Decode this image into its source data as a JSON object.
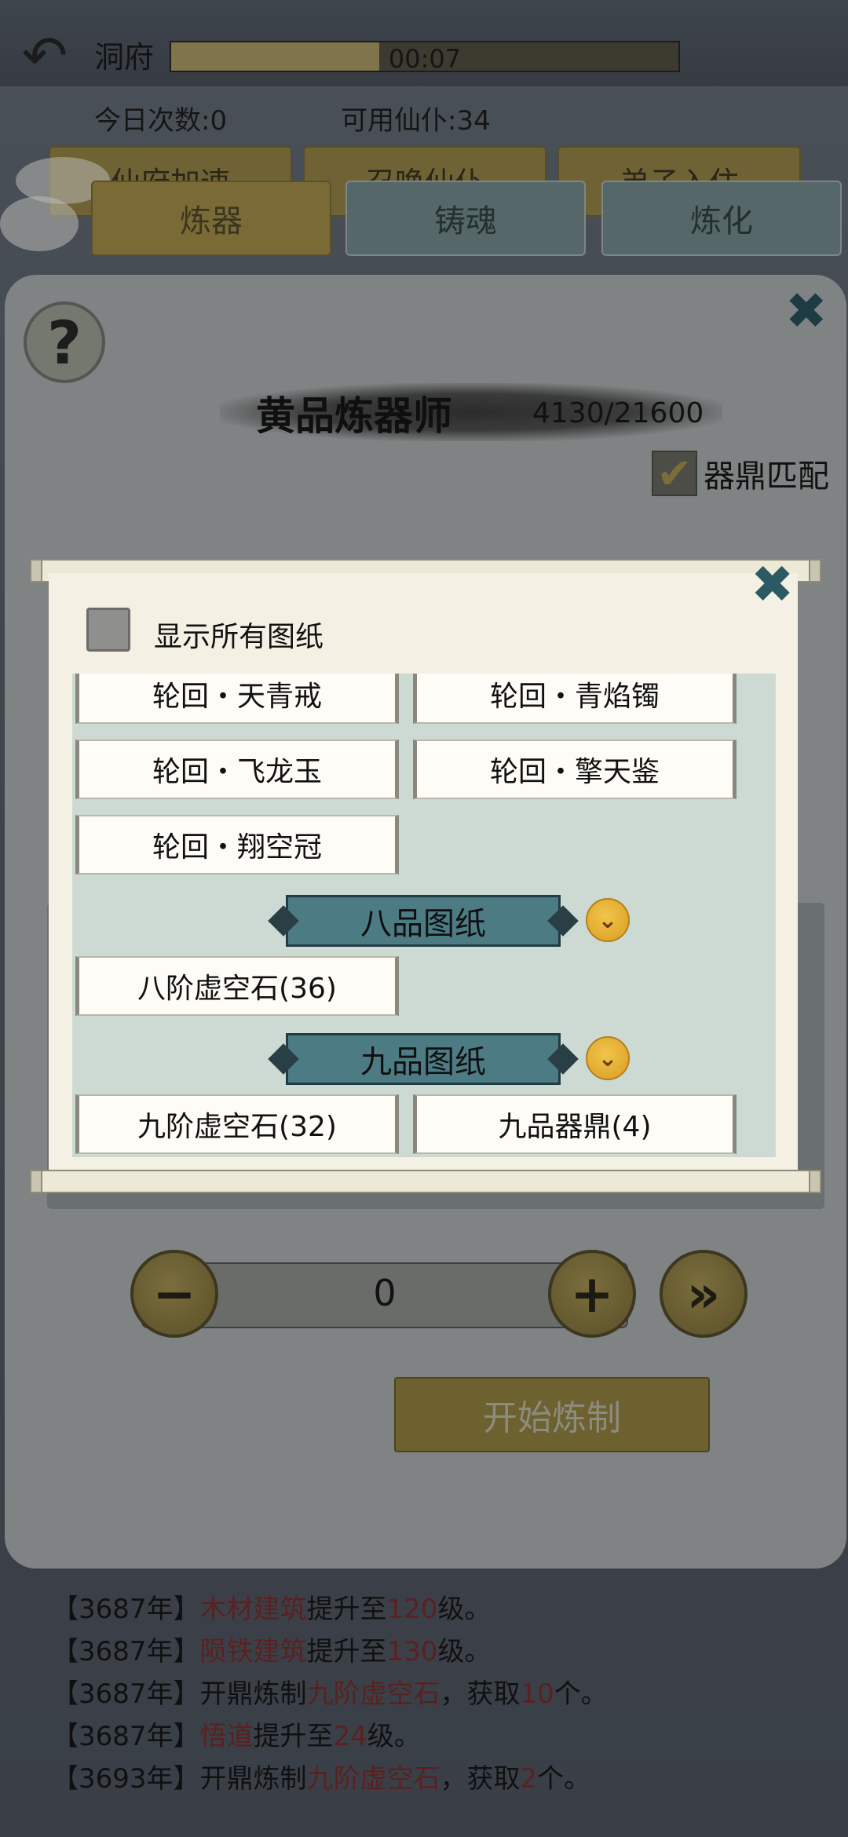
{
  "header": {
    "title": "洞府",
    "timer": "00:07",
    "timer_progress": 0.41,
    "stats": {
      "daily_count": "今日次数:0",
      "available_servants": "可用仙仆:34"
    },
    "bg_buttons": [
      "仙府加速",
      "召唤仙仆",
      "弟子入住"
    ]
  },
  "tabs": [
    {
      "label": "炼器",
      "active": true
    },
    {
      "label": "铸魂",
      "active": false
    },
    {
      "label": "炼化",
      "active": false
    }
  ],
  "panel": {
    "help_label": "?",
    "rank_title": "黄品炼器师",
    "rank_progress": "4130/21600",
    "match_label": "器鼎匹配",
    "match_checked": true
  },
  "dialog": {
    "show_all_label": "显示所有图纸",
    "items_top": [
      {
        "label": "轮回・天青戒"
      },
      {
        "label": "轮回・青焰镯"
      },
      {
        "label": "轮回・飞龙玉"
      },
      {
        "label": "轮回・擎天鉴"
      },
      {
        "label": "轮回・翔空冠"
      }
    ],
    "category_8": {
      "title": "八品图纸",
      "items": [
        {
          "label": "八阶虚空石(36)"
        }
      ]
    },
    "category_9": {
      "title": "九品图纸",
      "items": [
        {
          "label": "九阶虚空石(32)"
        },
        {
          "label": "九品器鼎(4)"
        }
      ]
    }
  },
  "controls": {
    "quantity": "0",
    "start_label": "开始炼制"
  },
  "log": [
    {
      "prefix": "【3687年】",
      "red1": "木材建筑",
      "mid": "提升至",
      "red2": "120",
      "suffix": "级。"
    },
    {
      "prefix": "【3687年】",
      "red1": "陨铁建筑",
      "mid": "提升至",
      "red2": "130",
      "suffix": "级。"
    },
    {
      "prefix": "【3687年】开鼎炼制",
      "red1": "九阶虚空石",
      "mid": "，获取",
      "red2": "10",
      "suffix": "个。"
    },
    {
      "prefix": "【3687年】",
      "red1": "悟道",
      "mid": "提升至",
      "red2": "24",
      "suffix": "级。"
    },
    {
      "prefix": "【3693年】开鼎炼制",
      "red1": "九阶虚空石",
      "mid": "，获取",
      "red2": "2",
      "suffix": "个。"
    }
  ]
}
